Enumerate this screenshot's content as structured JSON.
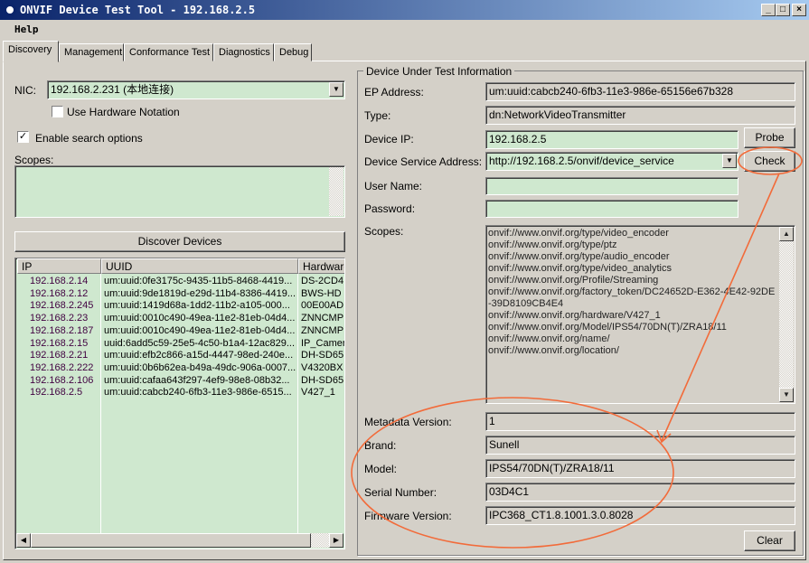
{
  "window": {
    "title": "ONVIF Device Test Tool - 192.168.2.5",
    "min": "_",
    "max": "□",
    "close": "×"
  },
  "menu": {
    "help": "Help"
  },
  "tabs": [
    "Discovery",
    "Management",
    "Conformance Test",
    "Diagnostics",
    "Debug"
  ],
  "discovery": {
    "nic_label": "NIC:",
    "nic_value": "192.168.2.231 (本地连接)",
    "use_hw_notation": "Use Hardware Notation",
    "enable_search": "Enable search options",
    "enable_search_checked": true,
    "scopes_label": "Scopes:",
    "discover_button": "Discover Devices",
    "columns": [
      "IP",
      "UUID",
      "Hardware"
    ],
    "rows": [
      [
        "192.168.2.14",
        "um:uuid:0fe3175c-9435-11b5-8468-4419...",
        "DS-2CD4"
      ],
      [
        "192.168.2.12",
        "um:uuid:9de1819d-e29d-11b4-8386-4419...",
        "BWS-HD"
      ],
      [
        "192.168.2.245",
        "um:uuid:1419d68a-1dd2-11b2-a105-000...",
        "00E00AD"
      ],
      [
        "192.168.2.23",
        "um:uuid:0010c490-49ea-11e2-81eb-04d4...",
        "ZNNCMP"
      ],
      [
        "192.168.2.187",
        "um:uuid:0010c490-49ea-11e2-81eb-04d4...",
        "ZNNCMP"
      ],
      [
        "192.168.2.15",
        "uuid:6add5c59-25e5-4c50-b1a4-12ac829...",
        "IP_Camer"
      ],
      [
        "192.168.2.21",
        "um:uuid:efb2c866-a15d-4447-98ed-240e...",
        "DH-SD65"
      ],
      [
        "192.168.2.222",
        "um:uuid:0b6b62ea-b49a-49dc-906a-0007...",
        "V4320BX"
      ],
      [
        "192.168.2.106",
        "um:uuid:cafaa643f297-4ef9-98e8-08b32...",
        "DH-SD65"
      ],
      [
        "192.168.2.5",
        "um:uuid:cabcb240-6fb3-11e3-986e-6515...",
        "V427_1"
      ]
    ]
  },
  "dut": {
    "group_title": "Device Under Test Information",
    "ep_label": "EP Address:",
    "ep_value": "um:uuid:cabcb240-6fb3-11e3-986e-65156e67b328",
    "type_label": "Type:",
    "type_value": "dn:NetworkVideoTransmitter",
    "ip_label": "Device IP:",
    "ip_value": "192.168.2.5",
    "probe": "Probe",
    "service_label": "Device Service Address:",
    "service_value": "http://192.168.2.5/onvif/device_service",
    "check": "Check",
    "user_label": "User Name:",
    "user_value": "",
    "pass_label": "Password:",
    "pass_value": "",
    "scopes_label": "Scopes:",
    "scopes": [
      "onvif://www.onvif.org/type/video_encoder",
      "onvif://www.onvif.org/type/ptz",
      "onvif://www.onvif.org/type/audio_encoder",
      "onvif://www.onvif.org/type/video_analytics",
      "onvif://www.onvif.org/Profile/Streaming",
      "onvif://www.onvif.org/factory_token/DC24652D-E362-4E42-92DE",
      "-39D8109CB4E4",
      "onvif://www.onvif.org/hardware/V427_1",
      "onvif://www.onvif.org/Model/IPS54/70DN(T)/ZRA18/11",
      "onvif://www.onvif.org/name/",
      "onvif://www.onvif.org/location/"
    ],
    "metadata_label": "Metadata Version:",
    "metadata_value": "1",
    "brand_label": "Brand:",
    "brand_value": "Sunell",
    "model_label": "Model:",
    "model_value": "IPS54/70DN(T)/ZRA18/11",
    "serial_label": "Serial Number:",
    "serial_value": "03D4C1",
    "firmware_label": "Firmware Version:",
    "firmware_value": "IPC368_CT1.8.1001.3.0.8028",
    "clear": "Clear"
  },
  "annotation_color": "#f26b3a"
}
